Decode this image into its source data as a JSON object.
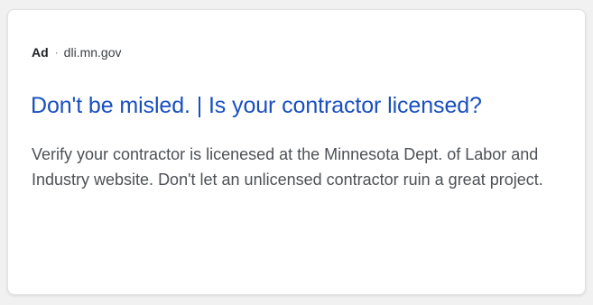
{
  "ad": {
    "label": "Ad",
    "separator": "·",
    "domain": "dli.mn.gov",
    "headline": "Don't be misled. | Is your contractor licensed?",
    "description": "Verify your contractor is licenesed at the Minnesota Dept. of Labor and Industry website. Don't let an unlicensed contractor ruin a great project."
  },
  "colors": {
    "headline_link": "#1a4fbf",
    "body_text": "#4d5156",
    "background": "#f1f1f1",
    "card": "#ffffff"
  }
}
